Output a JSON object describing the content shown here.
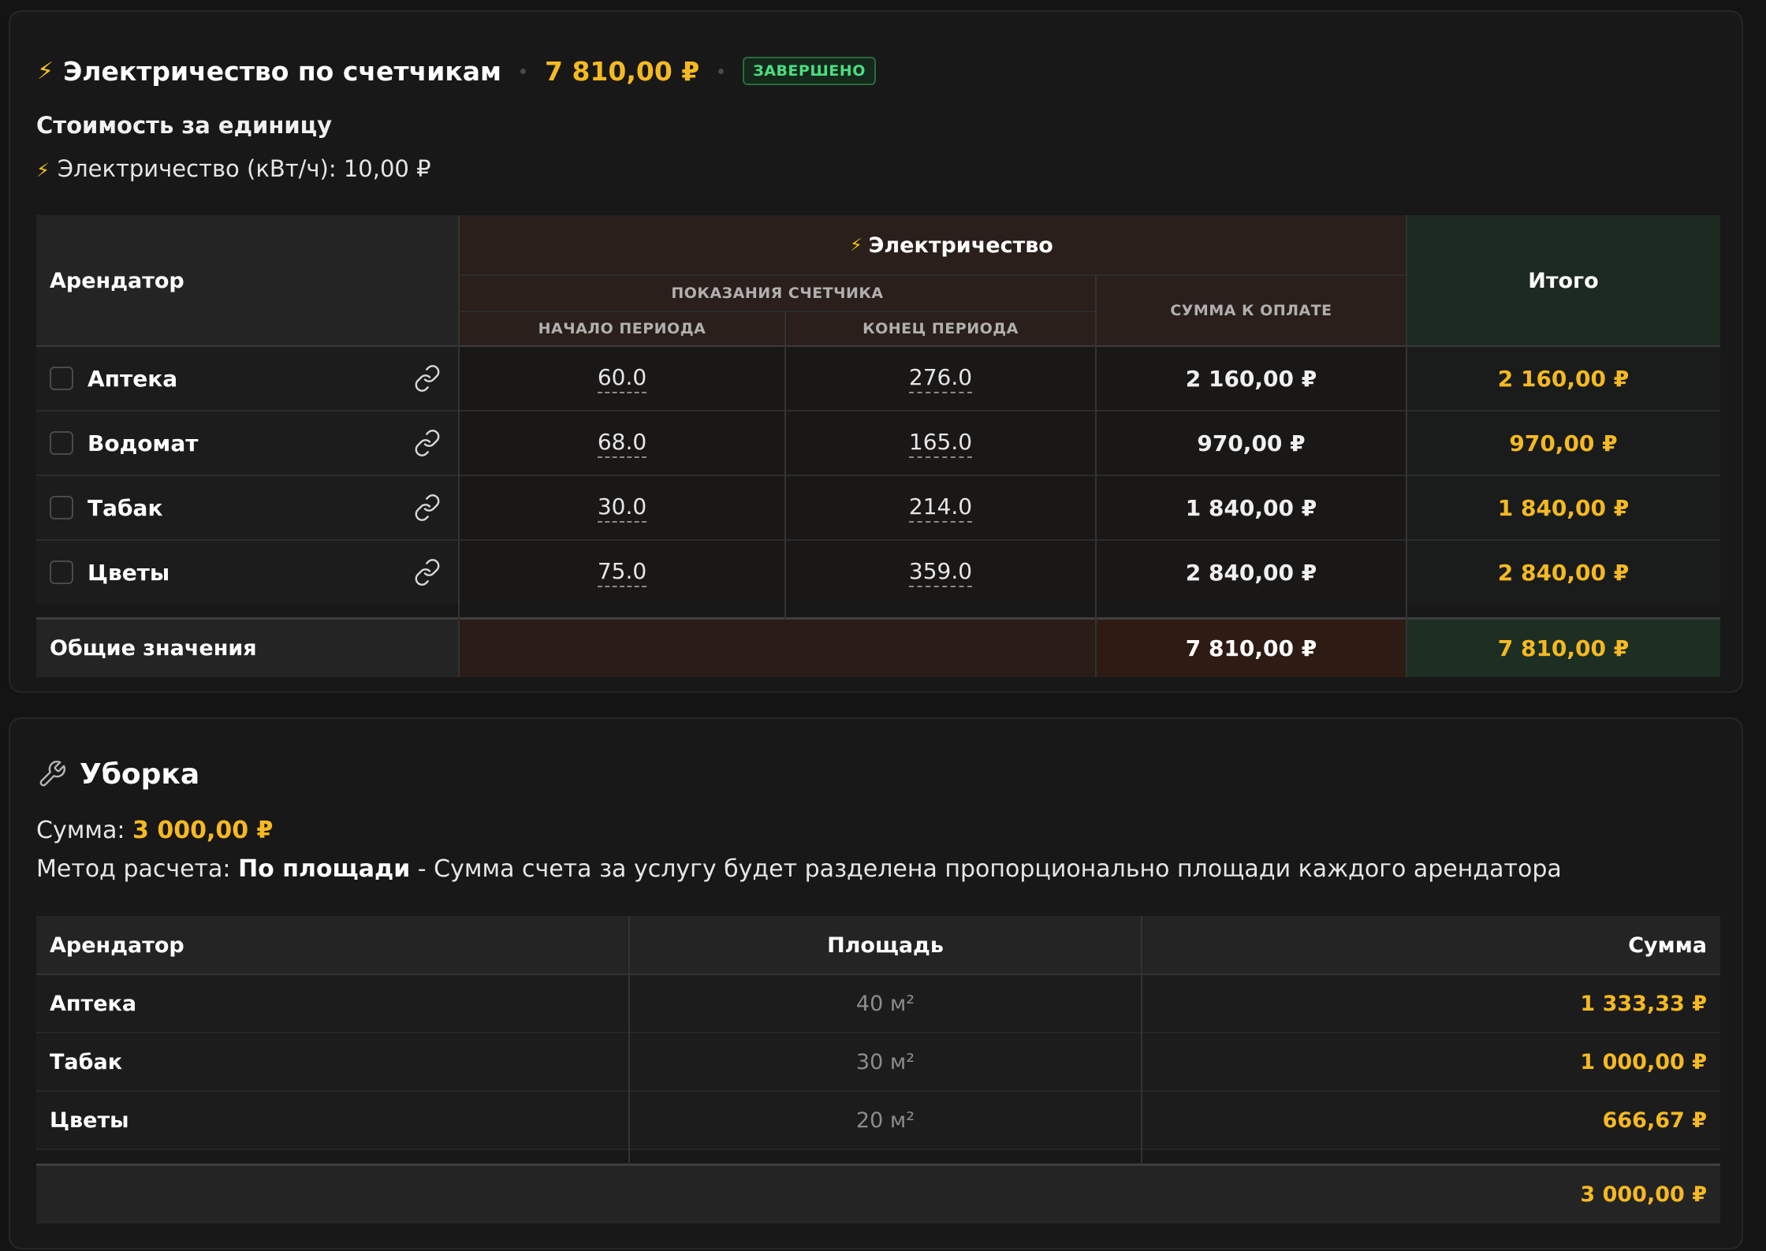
{
  "electricity": {
    "title": "Электричество по счетчикам",
    "total": "7 810,00 ₽",
    "status": "ЗАВЕРШЕНО",
    "unit_cost_heading": "Стоимость за единицу",
    "unit_cost_line": "Электричество (кВт/ч): 10,00 ₽",
    "table": {
      "col_tenant": "Арендатор",
      "col_group": "Электричество",
      "col_meter_readings": "ПОКАЗАНИЯ СЧЕТЧИКА",
      "col_period_start": "НАЧАЛО ПЕРИОДА",
      "col_period_end": "КОНЕЦ ПЕРИОДА",
      "col_amount_due": "СУММА К ОПЛАТЕ",
      "col_total": "Итого",
      "rows": [
        {
          "tenant": "Аптека",
          "start": "60.0",
          "end": "276.0",
          "amount": "2 160,00 ₽",
          "total": "2 160,00 ₽"
        },
        {
          "tenant": "Водомат",
          "start": "68.0",
          "end": "165.0",
          "amount": "970,00 ₽",
          "total": "970,00 ₽"
        },
        {
          "tenant": "Табак",
          "start": "30.0",
          "end": "214.0",
          "amount": "1 840,00 ₽",
          "total": "1 840,00 ₽"
        },
        {
          "tenant": "Цветы",
          "start": "75.0",
          "end": "359.0",
          "amount": "2 840,00 ₽",
          "total": "2 840,00 ₽"
        }
      ],
      "footer_label": "Общие значения",
      "footer_amount": "7 810,00 ₽",
      "footer_total": "7 810,00 ₽"
    }
  },
  "cleaning": {
    "title": "Уборка",
    "sum_label": "Сумма:",
    "sum_value": "3 000,00 ₽",
    "method_label": "Метод расчета:",
    "method_value": "По площади",
    "method_desc": " - Сумма счета за услугу будет разделена пропорционально площади каждого арендатора",
    "table": {
      "col_tenant": "Арендатор",
      "col_area": "Площадь",
      "col_sum": "Сумма",
      "rows": [
        {
          "tenant": "Аптека",
          "area": "40 м²",
          "sum": "1 333,33 ₽"
        },
        {
          "tenant": "Табак",
          "area": "30 м²",
          "sum": "1 000,00 ₽"
        },
        {
          "tenant": "Цветы",
          "area": "20 м²",
          "sum": "666,67 ₽"
        }
      ],
      "footer_total": "3 000,00 ₽"
    }
  },
  "colors": {
    "accent": "#f5b921",
    "success": "#4ade80",
    "background": "#141414"
  },
  "icons": [
    "lightning-icon",
    "link-icon",
    "wrench-icon"
  ]
}
